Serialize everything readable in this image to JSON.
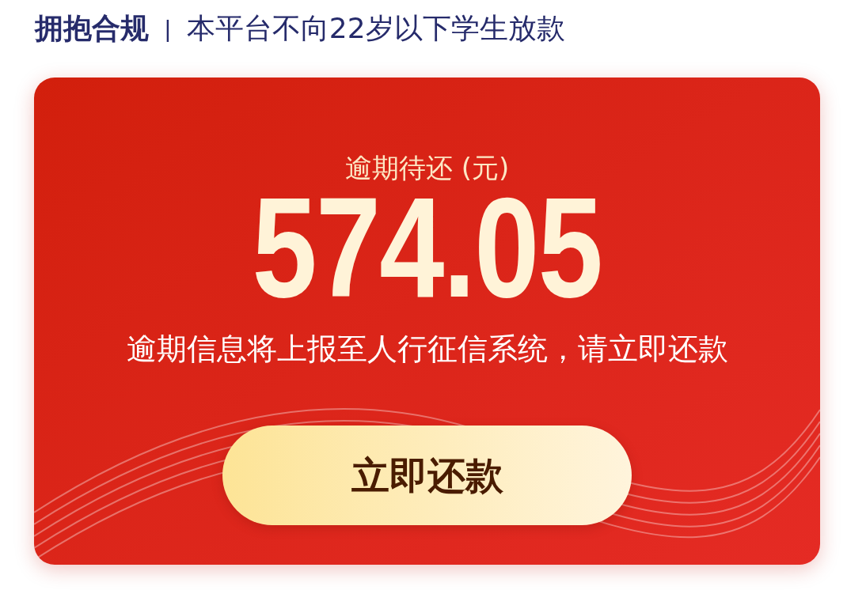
{
  "header": {
    "title": "拥抱合规",
    "separator": "|",
    "notice": "本平台不向22岁以下学生放款"
  },
  "card": {
    "label": "逾期待还 (元)",
    "amount": "574.05",
    "warning": "逾期信息将上报至人行征信系统，请立即还款",
    "button": "立即还款"
  }
}
